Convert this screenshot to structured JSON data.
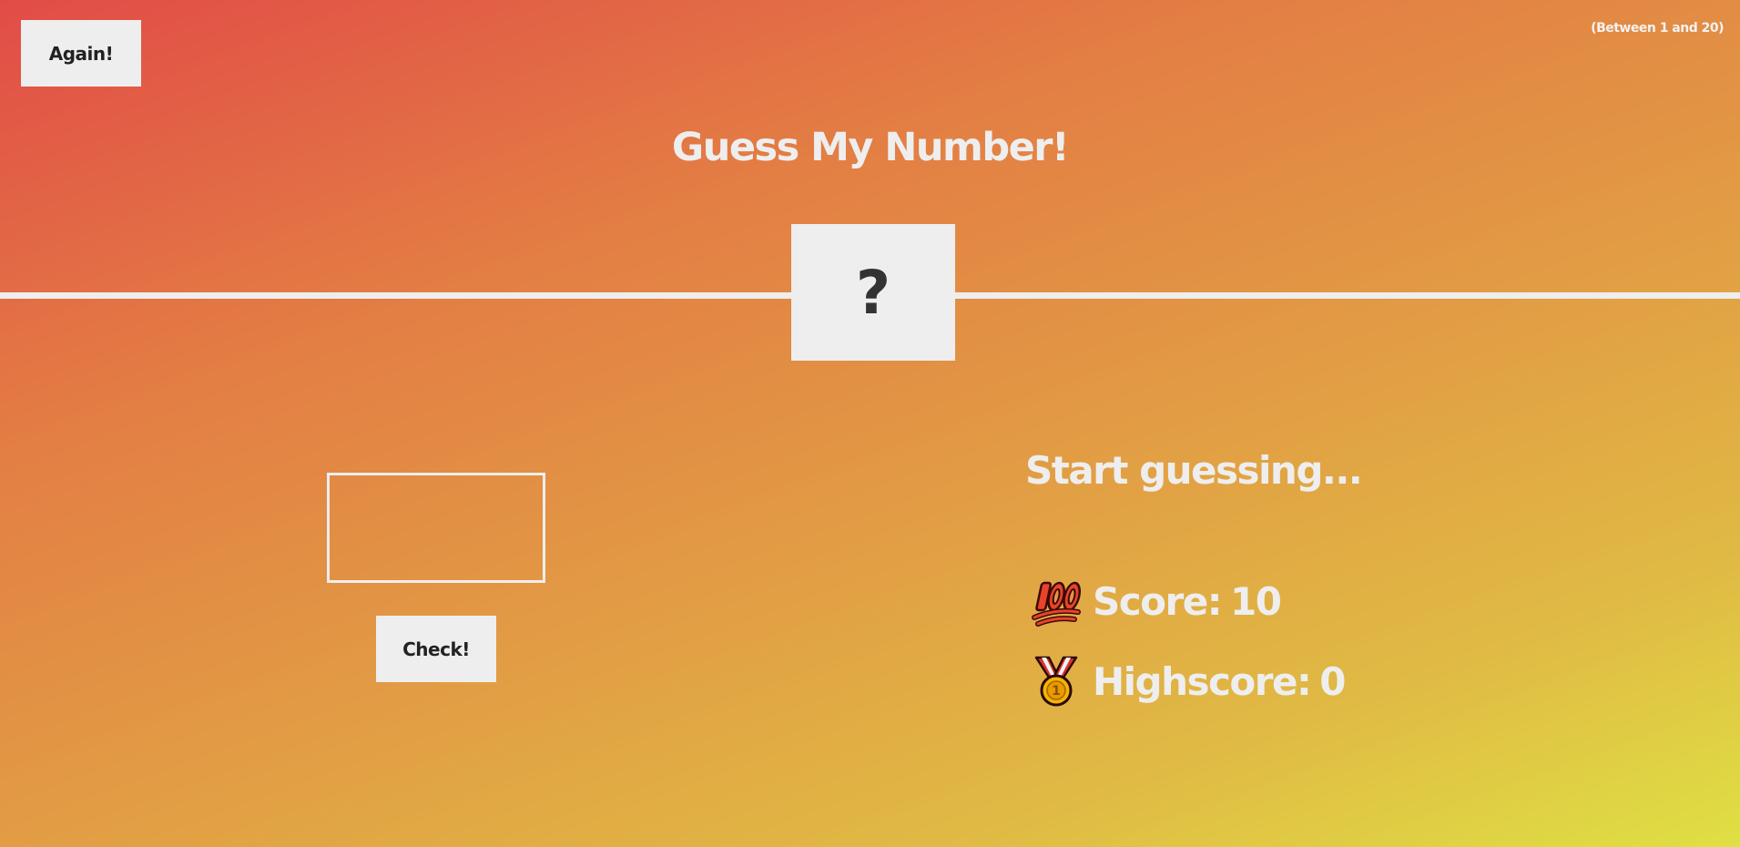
{
  "header": {
    "again_label": "Again!",
    "range_hint": "(Between 1 and 20)",
    "title": "Guess My Number!"
  },
  "secret": {
    "display": "?"
  },
  "controls": {
    "guess_value": "",
    "check_label": "Check!"
  },
  "status": {
    "message": "Start guessing...",
    "score_label": "Score:",
    "score": "10",
    "highscore_label": "Highscore:",
    "highscore": "0",
    "score_icon": "hundred-points-icon",
    "highscore_icon": "medal-icon"
  },
  "colors": {
    "gradient_start": "#e24c47",
    "gradient_end": "#dfe043",
    "panel": "#eeeeee",
    "dark_text": "#333333"
  }
}
